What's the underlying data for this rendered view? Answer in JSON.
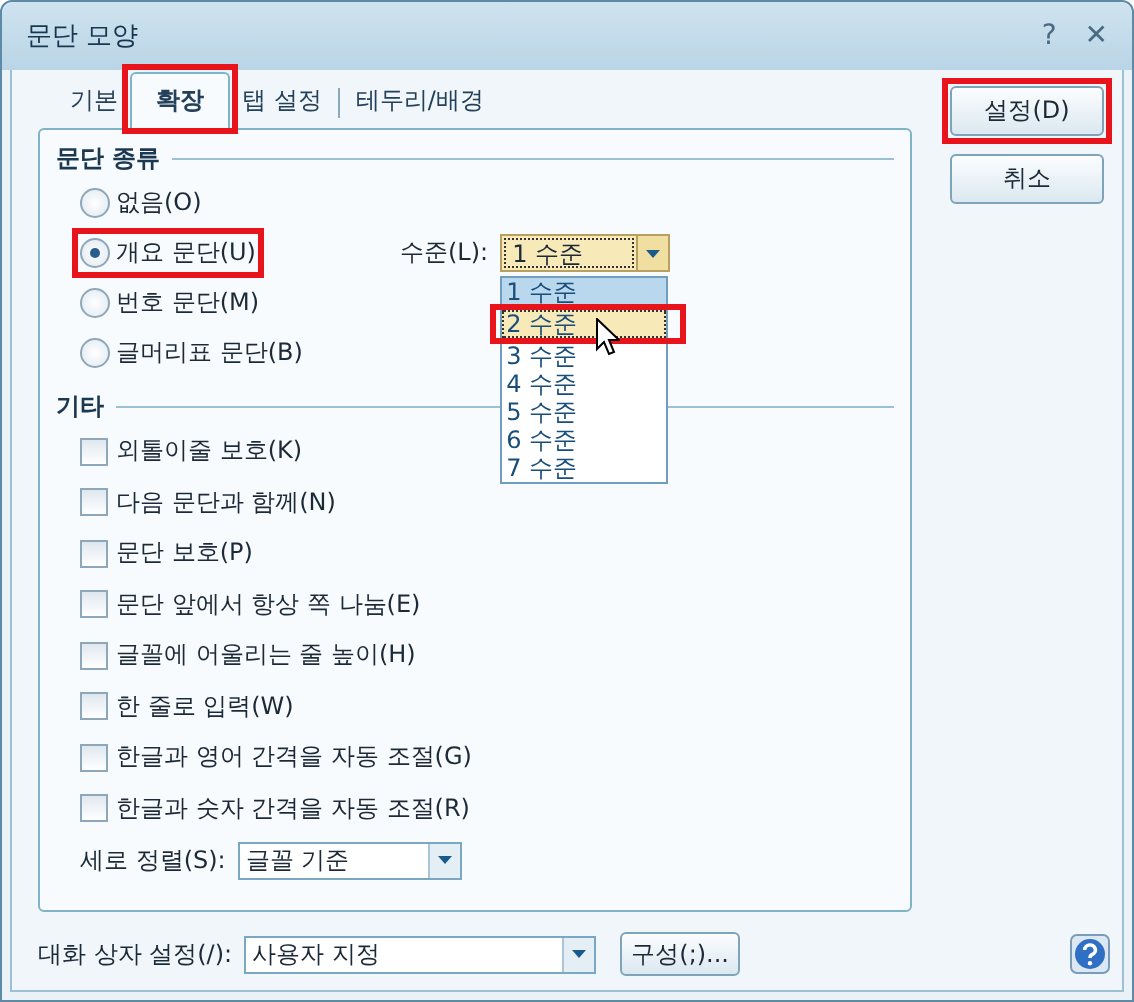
{
  "window": {
    "title": "문단 모양",
    "help_button": "?",
    "close_button": "✕"
  },
  "tabs": [
    {
      "label": "기본",
      "selected": false,
      "highlighted": false
    },
    {
      "label": "확장",
      "selected": true,
      "highlighted": true
    },
    {
      "label": "탭 설정",
      "selected": false,
      "highlighted": false
    },
    {
      "label": "테두리/배경",
      "selected": false,
      "highlighted": false
    }
  ],
  "buttons": [
    {
      "label": "설정(D)",
      "highlighted": true
    },
    {
      "label": "취소",
      "highlighted": false
    }
  ],
  "paragraph_type": {
    "title": "문단 종류",
    "options": [
      {
        "label": "없음(O)",
        "selected": false,
        "highlighted": false
      },
      {
        "label": "개요 문단(U)",
        "selected": true,
        "highlighted": true
      },
      {
        "label": "번호 문단(M)",
        "selected": false,
        "highlighted": false
      },
      {
        "label": "글머리표 문단(B)",
        "selected": false,
        "highlighted": false
      }
    ],
    "level": {
      "label": "수준(L):",
      "value": "1 수준",
      "expanded": true,
      "list": [
        {
          "label": "1 수준",
          "selected": true,
          "hovered": false,
          "highlighted": false
        },
        {
          "label": "2 수준",
          "selected": false,
          "hovered": true,
          "highlighted": true
        },
        {
          "label": "3 수준",
          "selected": false,
          "hovered": false,
          "highlighted": false
        },
        {
          "label": "4 수준",
          "selected": false,
          "hovered": false,
          "highlighted": false
        },
        {
          "label": "5 수준",
          "selected": false,
          "hovered": false,
          "highlighted": false
        },
        {
          "label": "6 수준",
          "selected": false,
          "hovered": false,
          "highlighted": false
        },
        {
          "label": "7 수준",
          "selected": false,
          "hovered": false,
          "highlighted": false
        }
      ]
    }
  },
  "other": {
    "title": "기타",
    "options": [
      {
        "label": "외톨이줄 보호(K)",
        "checked": false
      },
      {
        "label": "다음 문단과 함께(N)",
        "checked": false
      },
      {
        "label": "문단 보호(P)",
        "checked": false
      },
      {
        "label": "문단 앞에서 항상 쪽 나눔(E)",
        "checked": false
      },
      {
        "label": "글꼴에 어울리는 줄 높이(H)",
        "checked": false
      },
      {
        "label": "한 줄로 입력(W)",
        "checked": false
      },
      {
        "label": "한글과 영어 간격을 자동 조절(G)",
        "checked": false
      },
      {
        "label": "한글과 숫자 간격을 자동 조절(R)",
        "checked": false
      }
    ],
    "vertical_align": {
      "label": "세로 정렬(S):",
      "value": "글꼴 기준"
    }
  },
  "footer": {
    "label": "대화 상자 설정(/):",
    "value": "사용자 지정",
    "configure_button": "구성(;)..."
  }
}
